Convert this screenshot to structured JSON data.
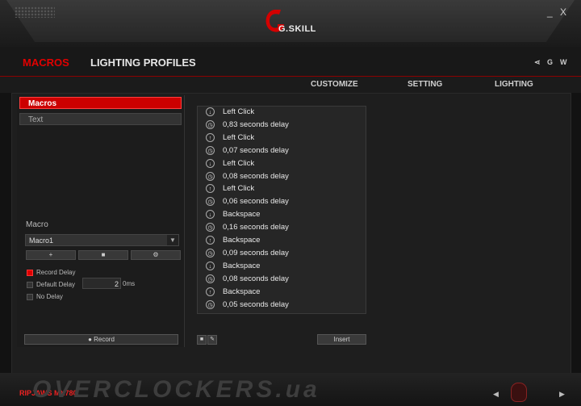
{
  "window": {
    "brand": "G.SKILL",
    "minimize": "_",
    "close": "X"
  },
  "nav": {
    "tabs": [
      {
        "label": "MACROS",
        "active": true
      },
      {
        "label": "LIGHTING PROFILES",
        "active": false
      }
    ],
    "right_g": "G",
    "right_w": "W"
  },
  "subnav": [
    "CUSTOMIZE",
    "SETTING",
    "LIGHTING"
  ],
  "left": {
    "menu": [
      "Macros",
      "Text"
    ],
    "macro_label": "Macro",
    "macro_select": "Macro1",
    "buttons": [
      "+",
      "■",
      "⚙"
    ],
    "options": {
      "record_delay": "Record Delay",
      "default_delay": "Default Delay",
      "default_value": "2",
      "unit": "0ms",
      "no_delay": "No Delay"
    },
    "record_button": "Record"
  },
  "events": [
    {
      "icon": "mouse-down-icon",
      "glyph": "↓",
      "text": "Left Click"
    },
    {
      "icon": "clock-icon",
      "glyph": "◷",
      "text": "0,83 seconds delay"
    },
    {
      "icon": "mouse-up-icon",
      "glyph": "↑",
      "text": "Left Click"
    },
    {
      "icon": "clock-icon",
      "glyph": "◷",
      "text": "0,07 seconds delay"
    },
    {
      "icon": "mouse-down-icon",
      "glyph": "↓",
      "text": "Left Click"
    },
    {
      "icon": "clock-icon",
      "glyph": "◷",
      "text": "0,08 seconds delay"
    },
    {
      "icon": "mouse-up-icon",
      "glyph": "↑",
      "text": "Left Click"
    },
    {
      "icon": "clock-icon",
      "glyph": "◷",
      "text": "0,06 seconds delay"
    },
    {
      "icon": "key-down-icon",
      "glyph": "↓",
      "text": "Backspace"
    },
    {
      "icon": "clock-icon",
      "glyph": "◷",
      "text": "0,16 seconds delay"
    },
    {
      "icon": "key-up-icon",
      "glyph": "↑",
      "text": "Backspace"
    },
    {
      "icon": "clock-icon",
      "glyph": "◷",
      "text": "0,09 seconds delay"
    },
    {
      "icon": "key-down-icon",
      "glyph": "↓",
      "text": "Backspace"
    },
    {
      "icon": "clock-icon",
      "glyph": "◷",
      "text": "0,08 seconds delay"
    },
    {
      "icon": "key-up-icon",
      "glyph": "↑",
      "text": "Backspace"
    },
    {
      "icon": "clock-icon",
      "glyph": "◷",
      "text": "0,05 seconds delay"
    }
  ],
  "list_tools": {
    "delete": "■",
    "edit": "✎"
  },
  "insert_button": "Insert",
  "footer": {
    "model": "RIPJAWS MX780",
    "watermark": "OVERCLOCKERS.ua",
    "prev": "◀",
    "next": "▶"
  },
  "colors": {
    "accent": "#cc0000",
    "bg": "#121212"
  }
}
